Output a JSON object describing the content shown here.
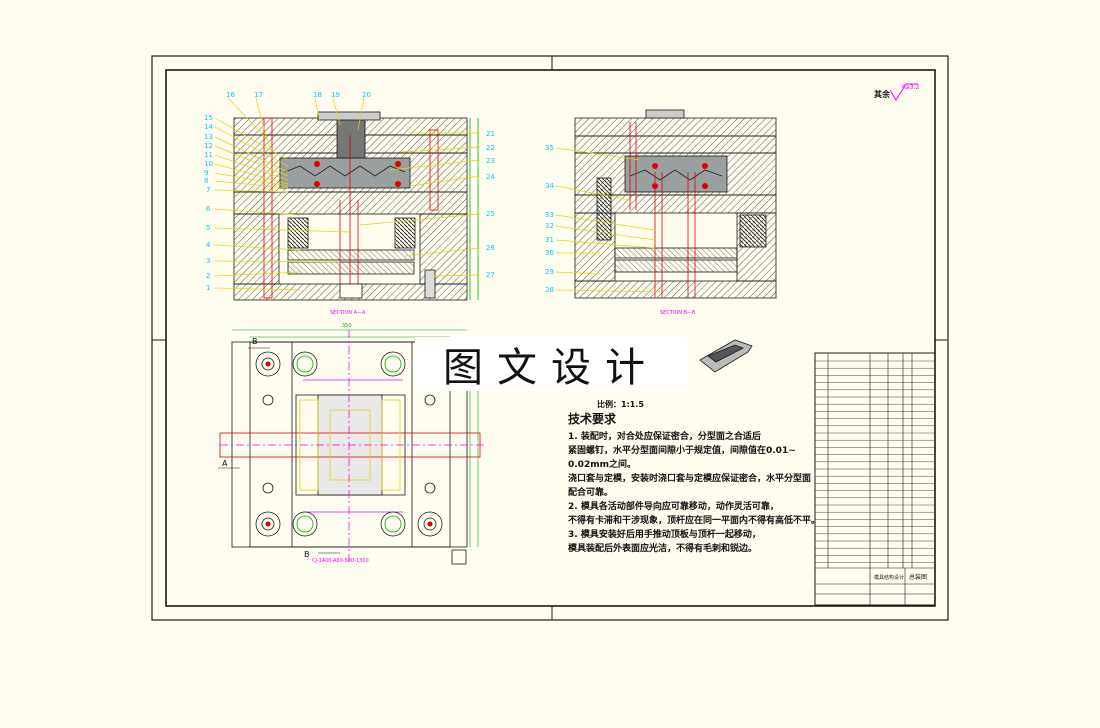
{
  "drawing": {
    "watermark": "图文设计",
    "section_aa_label": "SECTION A—A",
    "section_bb_label": "SECTION B—B",
    "scale_text": "比例：1:1.5",
    "roughness_label": "其余",
    "roughness_value": "Ra3.2",
    "part_no_label": "CJ-1400-A60-500-1300",
    "view_marks": [
      "A",
      "A",
      "B",
      "B"
    ],
    "overall_dim": "350",
    "title_block": {
      "drawing_title": "总装图",
      "title_name": "模具结构设计"
    }
  },
  "tech_requirements": {
    "title": "技术要求",
    "lines": [
      "1. 装配时，对合处应保证密合，分型面之合适后",
      "紧固螺钉，水平分型面间隙小于规定值，间隙值在0.01~",
      "0.02mm之间。",
      "浇口套与定模，安装时浇口套与定模应保证密合，水平分型面",
      "配合可靠。",
      "2. 模具各活动部件导向应可靠移动，动作灵活可靠，",
      "不得有卡滞和干涉现象，顶杆应在同一平面内不得有高低不平。",
      "3. 模具安装好后用手推动顶板与顶杆一起移动，",
      "模具装配后外表面应光洁，不得有毛刺和锐边。"
    ]
  },
  "callouts_aa": [
    "16",
    "17",
    "18",
    "19",
    "20",
    "15",
    "14",
    "13",
    "12",
    "11",
    "10",
    "9",
    "8",
    "7",
    "6",
    "5",
    "4",
    "3",
    "2",
    "1",
    "21",
    "22",
    "23",
    "24",
    "25",
    "26",
    "27"
  ],
  "callouts_bb": [
    "35",
    "34",
    "33",
    "32",
    "31",
    "30",
    "29",
    "28"
  ],
  "colors": {
    "line": "#1a1a1a",
    "callout": "#00cfff",
    "leader": "#ffea00",
    "red": "#e00000",
    "magenta": "#ff00ff",
    "green": "#00b000"
  }
}
